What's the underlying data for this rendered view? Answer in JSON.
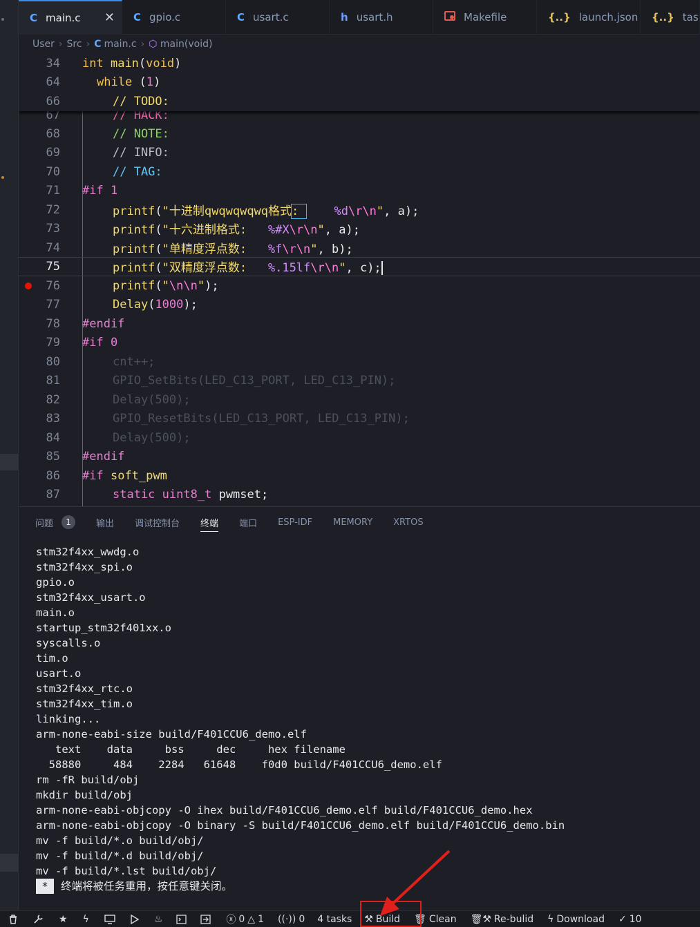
{
  "tabs": [
    {
      "icon": "C",
      "label": "main.c",
      "active": true,
      "close": "✕"
    },
    {
      "icon": "C",
      "label": "gpio.c"
    },
    {
      "icon": "C",
      "label": "usart.c"
    },
    {
      "icon": "h",
      "label": "usart.h"
    },
    {
      "icon": "mk",
      "label": "Makefile"
    },
    {
      "icon": "{..}",
      "label": "launch.json"
    },
    {
      "icon": "{..}",
      "label": "tasks."
    }
  ],
  "breadcrumb": [
    "User",
    "Src",
    "main.c",
    "main(void)"
  ],
  "sticky": [
    {
      "ln": "34",
      "code": "int main(void)"
    },
    {
      "ln": "64",
      "code": "while (1)"
    },
    {
      "ln": "66",
      "code": "// TODO:"
    }
  ],
  "lines": [
    {
      "ln": "67",
      "text": "// HACK:"
    },
    {
      "ln": "68",
      "text": "// NOTE:"
    },
    {
      "ln": "69",
      "text": "// INFO:"
    },
    {
      "ln": "70",
      "text": "// TAG:"
    },
    {
      "ln": "71",
      "text": "#if 1"
    },
    {
      "ln": "72",
      "text": "printf(\"十进制qwqwqwqwq格式:     %d\\r\\n\", a);"
    },
    {
      "ln": "73",
      "text": "printf(\"十六进制格式:   %#X\\r\\n\", a);"
    },
    {
      "ln": "74",
      "text": "printf(\"单精度浮点数:   %f\\r\\n\", b);"
    },
    {
      "ln": "75",
      "text": "printf(\"双精度浮点数:   %.15lf\\r\\n\", c);"
    },
    {
      "ln": "76",
      "text": "printf(\"\\n\\n\");"
    },
    {
      "ln": "77",
      "text": "Delay(1000);"
    },
    {
      "ln": "78",
      "text": "#endif"
    },
    {
      "ln": "79",
      "text": "#if 0"
    },
    {
      "ln": "80",
      "text": "cnt++;"
    },
    {
      "ln": "81",
      "text": "GPIO_SetBits(LED_C13_PORT, LED_C13_PIN);"
    },
    {
      "ln": "82",
      "text": "Delay(500);"
    },
    {
      "ln": "83",
      "text": "GPIO_ResetBits(LED_C13_PORT, LED_C13_PIN);"
    },
    {
      "ln": "84",
      "text": "Delay(500);"
    },
    {
      "ln": "85",
      "text": "#endif"
    },
    {
      "ln": "86",
      "text": "#if soft_pwm"
    },
    {
      "ln": "87",
      "text": "static uint8_t pwmset;"
    }
  ],
  "panel_tabs": [
    {
      "label": "问题",
      "badge": "1"
    },
    {
      "label": "输出"
    },
    {
      "label": "调试控制台"
    },
    {
      "label": "终端",
      "active": true
    },
    {
      "label": "端口"
    },
    {
      "label": "ESP-IDF"
    },
    {
      "label": "MEMORY"
    },
    {
      "label": "XRTOS"
    }
  ],
  "terminal": [
    "stm32f4xx_wwdg.o",
    "stm32f4xx_spi.o",
    "gpio.o",
    "stm32f4xx_usart.o",
    "main.o",
    "startup_stm32f401xx.o",
    "syscalls.o",
    "tim.o",
    "usart.o",
    "stm32f4xx_rtc.o",
    "stm32f4xx_tim.o",
    "linking...",
    "arm-none-eabi-size build/F401CCU6_demo.elf",
    "   text    data     bss     dec     hex filename",
    "  58880     484    2284   61648    f0d0 build/F401CCU6_demo.elf",
    "rm -fR build/obj",
    "mkdir build/obj",
    "arm-none-eabi-objcopy -O ihex build/F401CCU6_demo.elf build/F401CCU6_demo.hex",
    "arm-none-eabi-objcopy -O binary -S build/F401CCU6_demo.elf build/F401CCU6_demo.bin",
    "mv -f build/*.o build/obj/",
    "mv -f build/*.d build/obj/",
    "mv -f build/*.lst build/obj/"
  ],
  "terminal_reuse": {
    "mark": "*",
    "text": "终端将被任务重用，按任意键关闭。"
  },
  "status": {
    "errors": "0",
    "warnings": "1",
    "ports": "0",
    "tasks": "4 tasks",
    "build": "Build",
    "clean": "Clean",
    "rebuild": "Re-bulid",
    "download": "Download",
    "check": "10"
  },
  "colors": {
    "accent": "#3b8eea",
    "breakpoint": "#e51400",
    "highlight_box": "#e0201a"
  }
}
